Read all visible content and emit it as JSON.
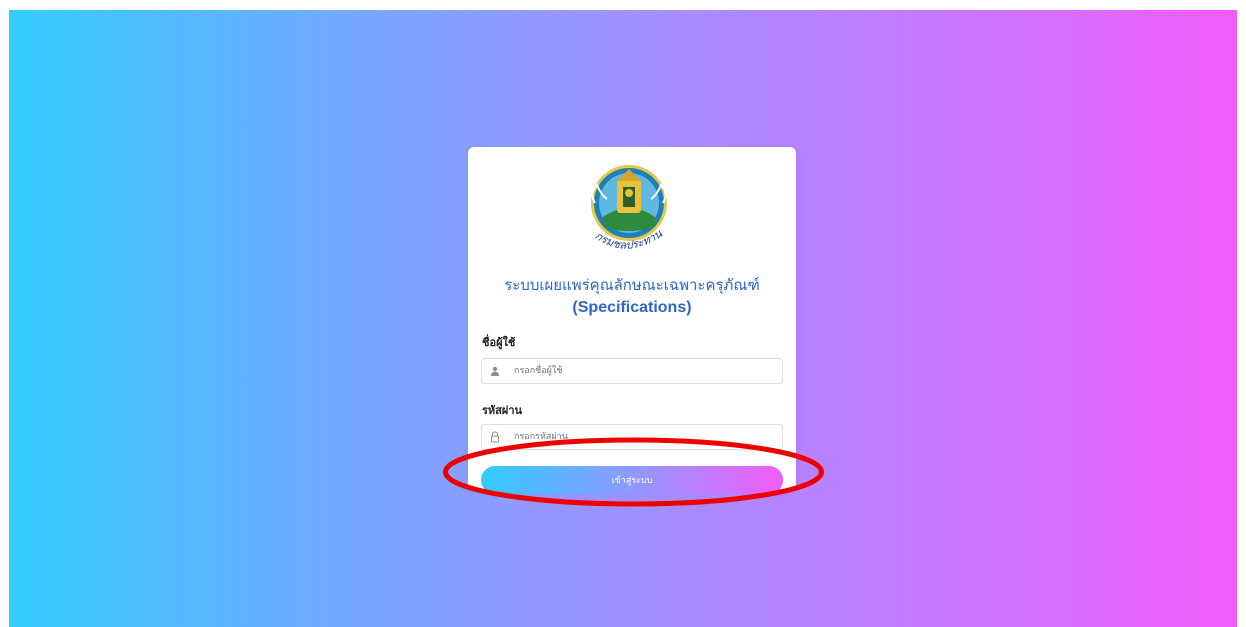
{
  "login_card": {
    "logo_text": "กรมชลประทาน",
    "title_thai": "ระบบเผยแพร่คุณลักษณะเฉพาะครุภัณฑ์",
    "title_en": "(Specifications)",
    "username_label": "ชื่อผู้ใช้",
    "username_placeholder": "กรอกชื่อผู้ใช้",
    "password_label": "รหัสผ่าน",
    "password_placeholder": "กรอกรหัสผ่าน",
    "login_button_label": "เข้าสู่ระบบ"
  },
  "icons": {
    "username": "user-icon",
    "password": "lock-icon"
  },
  "colors": {
    "gradient_start": "#33ccff",
    "gradient_end": "#f25cf7",
    "title_blue": "#2f66c8",
    "highlight_red": "#ee0000"
  }
}
